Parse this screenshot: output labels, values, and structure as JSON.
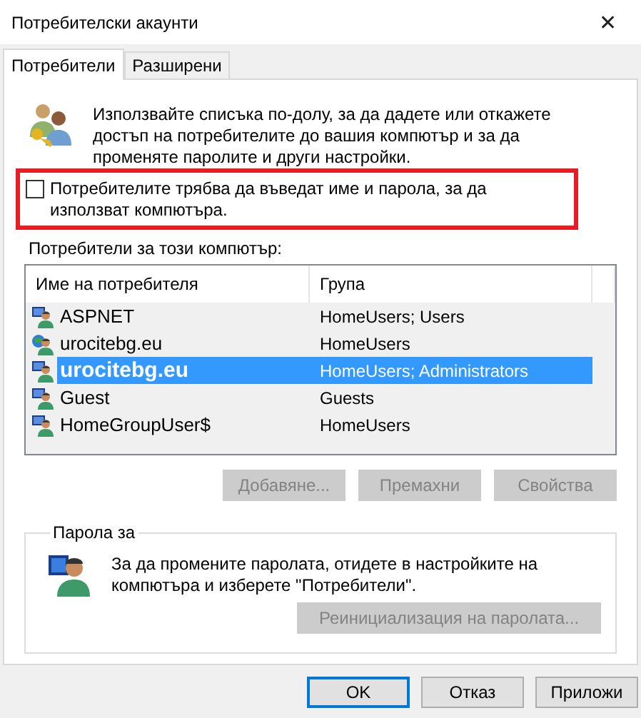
{
  "window": {
    "title": "Потребителски акаунти",
    "close": "✕"
  },
  "tabs": [
    {
      "label": "Потребители",
      "selected": true
    },
    {
      "label": "Разширени",
      "selected": false
    }
  ],
  "intro": "Използвайте списъка по-долу, за да дадете или откажете достъп на потребителите до вашия компютър и за да променяте паролите и други настройки.",
  "require_login": {
    "label": "Потребителите трябва да въведат име и парола, за да използват компютъра.",
    "checked": false,
    "highlighted": true
  },
  "users_label": "Потребители за този компютър:",
  "table": {
    "columns": [
      "Име на потребителя",
      "Група"
    ],
    "rows": [
      {
        "name": "ASPNET",
        "group": "HomeUsers; Users",
        "kind": "local",
        "selected": false
      },
      {
        "name": "urocitebg.eu",
        "group": "HomeUsers",
        "kind": "online",
        "selected": false
      },
      {
        "name": "urocitebg.eu",
        "group": "HomeUsers; Administrators",
        "kind": "local",
        "selected": true
      },
      {
        "name": "Guest",
        "group": "Guests",
        "kind": "local",
        "selected": false
      },
      {
        "name": "HomeGroupUser$",
        "group": "HomeUsers",
        "kind": "local",
        "selected": false
      }
    ]
  },
  "list_buttons": [
    {
      "label": "Добавяне...",
      "disabled": true
    },
    {
      "label": "Премахни",
      "disabled": true
    },
    {
      "label": "Свойства",
      "disabled": true
    }
  ],
  "password_group": {
    "legend": "Парола за",
    "text": "За да промените паролата, отидете в настройките на компютъра и изберете \"Потребители\".",
    "button": {
      "label": "Реинициализация на паролата...",
      "disabled": true
    }
  },
  "dialog_buttons": [
    {
      "label": "OK",
      "focused": true
    },
    {
      "label": "Отказ",
      "focused": false
    },
    {
      "label": "Приложи",
      "focused": false
    }
  ]
}
